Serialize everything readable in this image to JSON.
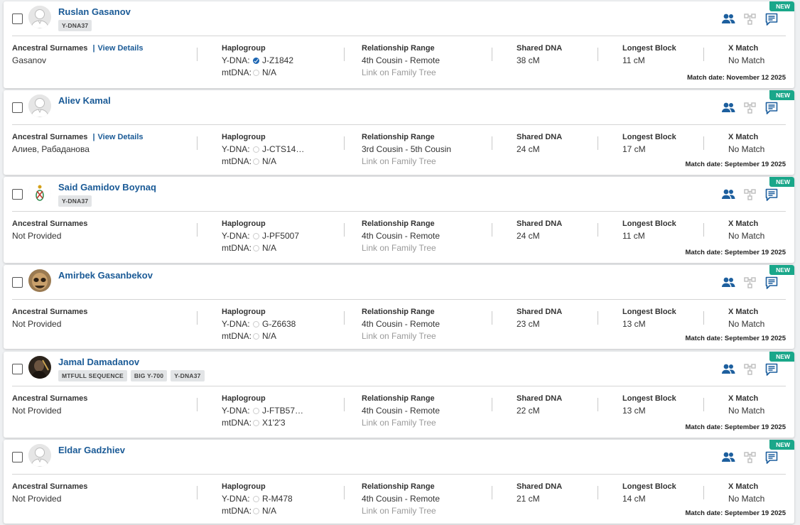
{
  "labels": {
    "ancestral_surnames": "Ancestral Surnames",
    "view_details": "View Details",
    "haplogroup": "Haplogroup",
    "ydna": "Y-DNA:",
    "mtdna": "mtDNA:",
    "relationship_range": "Relationship Range",
    "link_family_tree": "Link on Family Tree",
    "shared_dna": "Shared DNA",
    "longest_block": "Longest Block",
    "x_match": "X Match",
    "new_badge": "NEW",
    "match_date_prefix": "Match date:"
  },
  "colors": {
    "accent": "#1a5a96",
    "new_badge": "#1aa78a",
    "verified": "#1d66b3"
  },
  "matches": [
    {
      "name": "Ruslan Gasanov",
      "avatar": "default-silhouette",
      "tags": [
        "Y-DNA37"
      ],
      "surnames": "Gasanov",
      "show_view_details": true,
      "ydna": "J-Z1842",
      "ydna_verified": true,
      "mtdna": "N/A",
      "relationship": "4th Cousin - Remote",
      "shared_dna": "38 cM",
      "longest_block": "11 cM",
      "x_match": "No Match",
      "match_date": "November 12 2025"
    },
    {
      "name": "Aliev Kamal",
      "avatar": "default-silhouette",
      "tags": [],
      "surnames": "Алиев, Рабаданова",
      "show_view_details": true,
      "ydna": "J-CTS14…",
      "ydna_verified": false,
      "mtdna": "N/A",
      "relationship": "3rd Cousin - 5th Cousin",
      "shared_dna": "24 cM",
      "longest_block": "17 cM",
      "x_match": "No Match",
      "match_date": "September 19 2025"
    },
    {
      "name": "Said Gamidov Boynaq",
      "avatar": "emblem",
      "tags": [
        "Y-DNA37"
      ],
      "surnames": "Not Provided",
      "show_view_details": false,
      "ydna": "J-PF5007",
      "ydna_verified": false,
      "mtdna": "N/A",
      "relationship": "4th Cousin - Remote",
      "shared_dna": "24 cM",
      "longest_block": "11 cM",
      "x_match": "No Match",
      "match_date": "September 19 2025"
    },
    {
      "name": "Amirbek Gasanbekov",
      "avatar": "photo-face",
      "tags": [],
      "surnames": "Not Provided",
      "show_view_details": false,
      "ydna": "G-Z6638",
      "ydna_verified": false,
      "mtdna": "N/A",
      "relationship": "4th Cousin - Remote",
      "shared_dna": "23 cM",
      "longest_block": "13 cM",
      "x_match": "No Match",
      "match_date": "September 19 2025"
    },
    {
      "name": "Jamal Damadanov",
      "avatar": "photo-dark",
      "tags": [
        "MTFULL SEQUENCE",
        "BIG Y-700",
        "Y-DNA37"
      ],
      "surnames": "Not Provided",
      "show_view_details": false,
      "ydna": "J-FTB57…",
      "ydna_verified": false,
      "mtdna": "X1'2'3",
      "relationship": "4th Cousin - Remote",
      "shared_dna": "22 cM",
      "longest_block": "13 cM",
      "x_match": "No Match",
      "match_date": "September 19 2025"
    },
    {
      "name": "Eldar Gadzhiev",
      "avatar": "default-silhouette",
      "tags": [],
      "surnames": "Not Provided",
      "show_view_details": false,
      "ydna": "R-M478",
      "ydna_verified": false,
      "mtdna": "N/A",
      "relationship": "4th Cousin - Remote",
      "shared_dna": "21 cM",
      "longest_block": "14 cM",
      "x_match": "No Match",
      "match_date": "September 19 2025"
    }
  ]
}
